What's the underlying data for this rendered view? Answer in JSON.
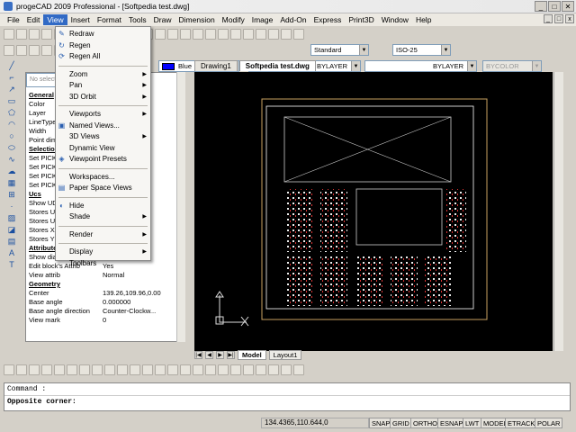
{
  "window": {
    "title": "progeCAD 2009 Professional - [Softpedia test.dwg]",
    "minimize": "_",
    "maximize": "□",
    "close": "✕"
  },
  "menu": [
    "File",
    "Edit",
    "View",
    "Insert",
    "Format",
    "Tools",
    "Draw",
    "Dimension",
    "Modify",
    "Image",
    "Add-On",
    "Express",
    "Print3D",
    "Window",
    "Help"
  ],
  "toolbar2": {
    "style": "Standard",
    "dimstyle": "ISO-25",
    "color": "Blue",
    "linetype": "BYLAYER",
    "lineweight": "BYLAYER",
    "plotstyle": "BYCOLOR"
  },
  "view_menu": [
    {
      "label": "Redraw",
      "icon": "redraw-icon"
    },
    {
      "label": "Regen",
      "icon": "regen-icon"
    },
    {
      "label": "Regen All",
      "icon": "regen-all-icon"
    },
    {
      "sep": true
    },
    {
      "label": "Zoom",
      "sub": true
    },
    {
      "label": "Pan",
      "sub": true
    },
    {
      "label": "3D Orbit",
      "sub": true
    },
    {
      "sep": true
    },
    {
      "label": "Viewports",
      "sub": true
    },
    {
      "label": "Named Views...",
      "icon": "named-views-icon"
    },
    {
      "label": "3D Views",
      "sub": true
    },
    {
      "label": "Dynamic View"
    },
    {
      "label": "Viewpoint Presets",
      "icon": "viewpoint-icon"
    },
    {
      "sep": true
    },
    {
      "label": "Workspaces..."
    },
    {
      "label": "Paper Space Views",
      "icon": "paper-space-icon"
    },
    {
      "sep": true
    },
    {
      "label": "Hide",
      "icon": "hide-icon"
    },
    {
      "label": "Shade",
      "sub": true
    },
    {
      "sep": true
    },
    {
      "label": "Render",
      "sub": true
    },
    {
      "sep": true
    },
    {
      "label": "Display",
      "sub": true
    },
    {
      "label": "Toolbars"
    }
  ],
  "props": {
    "select_placeholder": "No selecti",
    "rows": [
      {
        "k": "General",
        "hdr": true
      },
      {
        "k": "Color"
      },
      {
        "k": "Layer"
      },
      {
        "k": "LineType",
        "v": "R"
      },
      {
        "k": "Width"
      },
      {
        "k": "Point dim"
      },
      {
        "k": "Selection",
        "hdr": true
      },
      {
        "k": "Set PICK"
      },
      {
        "k": "Set PICK"
      },
      {
        "k": "Set PICK"
      },
      {
        "k": "Set PICK"
      },
      {
        "k": "Ucs",
        "hdr": true
      },
      {
        "k": "Show UD"
      },
      {
        "k": "Stores UC"
      },
      {
        "k": "Stores UC"
      },
      {
        "k": "Stores X"
      },
      {
        "k": "Stores Y"
      },
      {
        "k": "Attributes",
        "hdr": true
      },
      {
        "k": "Show dialog to edit attrib",
        "v": "No"
      },
      {
        "k": "Edit block's Attrib",
        "v": "Yes"
      },
      {
        "k": "View attrib",
        "v": "Normal"
      },
      {
        "k": "Geometry",
        "hdr": true
      },
      {
        "k": "Center",
        "v": "139.26,109.96,0.00"
      },
      {
        "k": "Base angle",
        "v": "0.000000"
      },
      {
        "k": "Base angle direction",
        "v": "Counter-Clockw..."
      },
      {
        "k": "View mark",
        "v": "0"
      }
    ]
  },
  "doc_tabs": [
    "Drawing1",
    "Softpedia test.dwg"
  ],
  "layout_tabs": [
    "Model",
    "Layout1"
  ],
  "command": {
    "line1": "Command :",
    "line2": "Opposite corner:"
  },
  "status": {
    "coords": "134.4365,110.644,0",
    "buttons": [
      "SNAP",
      "GRID",
      "ORTHO",
      "ESNAP",
      "LWT",
      "MODEL",
      "ETRACK",
      "POLAR"
    ]
  }
}
